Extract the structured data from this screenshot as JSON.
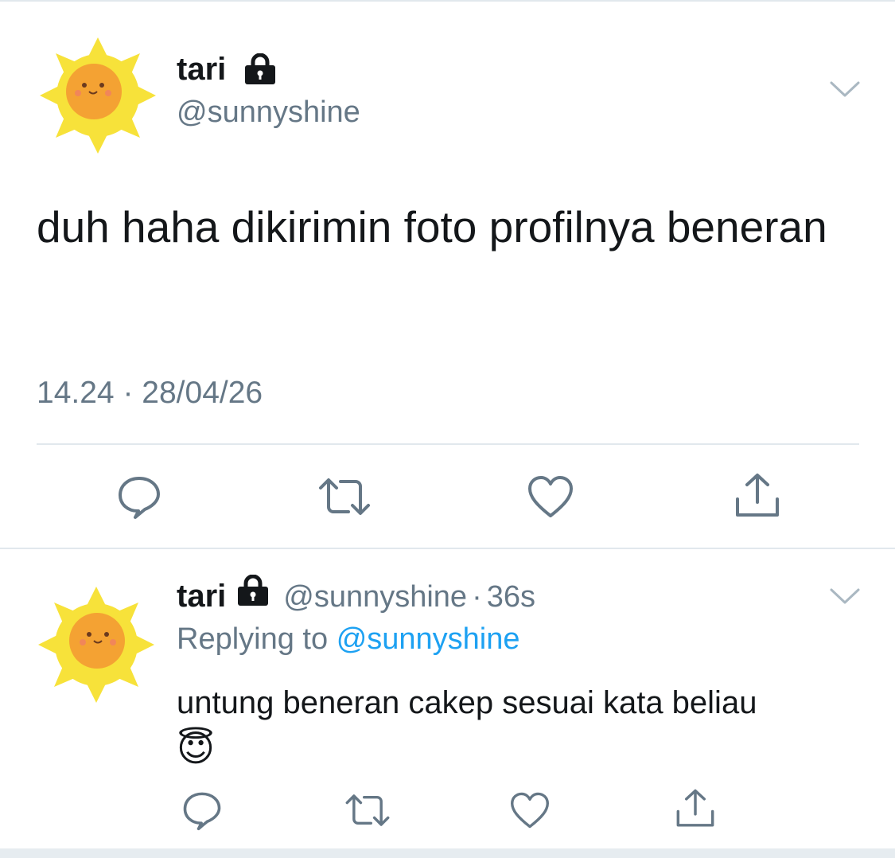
{
  "main_tweet": {
    "author_name": "tari",
    "author_handle": "@sunnyshine",
    "text": "duh haha dikirimin foto profilnya beneran",
    "time": "14.24",
    "separator": "·",
    "date": "28/04/26"
  },
  "reply_tweet": {
    "author_name": "tari",
    "author_handle": "@sunnyshine",
    "separator": "·",
    "age": "36s",
    "replying_to_label": "Replying to",
    "replying_to_handle": "@sunnyshine",
    "text": "untung beneran cakep sesuai kata beliau",
    "emoji": "😇"
  },
  "colors": {
    "text": "#14171a",
    "secondary": "#657786",
    "link": "#1da1f2",
    "divider": "#e1e8ed",
    "avatar_sun": "#f7e23a",
    "avatar_face": "#f4a233"
  },
  "icons": {
    "lock": "lock-icon",
    "chevron": "chevron-down-icon",
    "reply": "reply-icon",
    "retweet": "retweet-icon",
    "like": "like-icon",
    "share": "share-icon"
  }
}
